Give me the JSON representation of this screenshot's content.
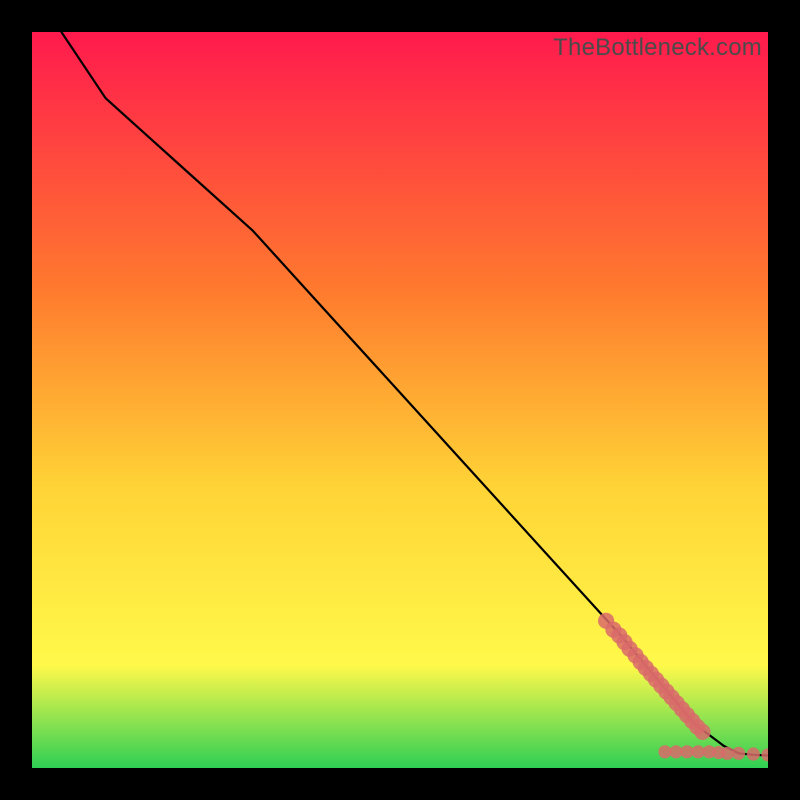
{
  "watermark": "TheBottleneck.com",
  "colors": {
    "bg_black": "#000000",
    "line": "#000000",
    "point": "#d96a6a",
    "gradient_top": "#ff1a4d",
    "gradient_mid1": "#ff7a2e",
    "gradient_mid2": "#ffd436",
    "gradient_mid3": "#fff94a",
    "gradient_bottom": "#2ecf54"
  },
  "chart_data": {
    "type": "line",
    "title": "",
    "xlabel": "",
    "ylabel": "",
    "xlim": [
      0,
      100
    ],
    "ylim": [
      0,
      100
    ],
    "grid": false,
    "legend": false,
    "series": [
      {
        "name": "curve",
        "x": [
          4,
          10,
          20,
          30,
          40,
          50,
          60,
          70,
          80,
          85,
          90,
          92,
          94,
          96,
          98,
          100
        ],
        "y": [
          100,
          91,
          82,
          73,
          62,
          51,
          40,
          29,
          18,
          12,
          6,
          4.5,
          3,
          2,
          1.8,
          1.7
        ]
      }
    ],
    "scatter": {
      "name": "points",
      "points": [
        {
          "x": 78.0,
          "y": 20.0,
          "r": 1.1
        },
        {
          "x": 79.0,
          "y": 18.8,
          "r": 1.1
        },
        {
          "x": 79.8,
          "y": 18.0,
          "r": 1.1
        },
        {
          "x": 80.5,
          "y": 17.1,
          "r": 1.1
        },
        {
          "x": 81.2,
          "y": 16.2,
          "r": 1.1
        },
        {
          "x": 82.0,
          "y": 15.3,
          "r": 1.1
        },
        {
          "x": 82.7,
          "y": 14.4,
          "r": 1.1
        },
        {
          "x": 83.4,
          "y": 13.6,
          "r": 1.1
        },
        {
          "x": 84.1,
          "y": 12.8,
          "r": 1.1
        },
        {
          "x": 84.8,
          "y": 12.0,
          "r": 1.1
        },
        {
          "x": 85.5,
          "y": 11.2,
          "r": 1.1
        },
        {
          "x": 86.2,
          "y": 10.4,
          "r": 1.1
        },
        {
          "x": 86.9,
          "y": 9.6,
          "r": 1.1
        },
        {
          "x": 87.6,
          "y": 8.8,
          "r": 1.1
        },
        {
          "x": 88.3,
          "y": 8.0,
          "r": 1.1
        },
        {
          "x": 89.0,
          "y": 7.2,
          "r": 1.1
        },
        {
          "x": 89.7,
          "y": 6.4,
          "r": 1.1
        },
        {
          "x": 90.4,
          "y": 5.6,
          "r": 1.1
        },
        {
          "x": 91.1,
          "y": 4.9,
          "r": 1.1
        },
        {
          "x": 86.0,
          "y": 2.2,
          "r": 0.9
        },
        {
          "x": 87.5,
          "y": 2.2,
          "r": 0.9
        },
        {
          "x": 89.0,
          "y": 2.2,
          "r": 0.9
        },
        {
          "x": 90.5,
          "y": 2.2,
          "r": 0.9
        },
        {
          "x": 92.0,
          "y": 2.2,
          "r": 0.9
        },
        {
          "x": 93.3,
          "y": 2.1,
          "r": 0.9
        },
        {
          "x": 94.5,
          "y": 2.0,
          "r": 0.9
        },
        {
          "x": 96.0,
          "y": 2.0,
          "r": 0.9
        },
        {
          "x": 98.0,
          "y": 1.9,
          "r": 0.9
        },
        {
          "x": 100.0,
          "y": 1.8,
          "r": 0.9
        }
      ]
    }
  }
}
